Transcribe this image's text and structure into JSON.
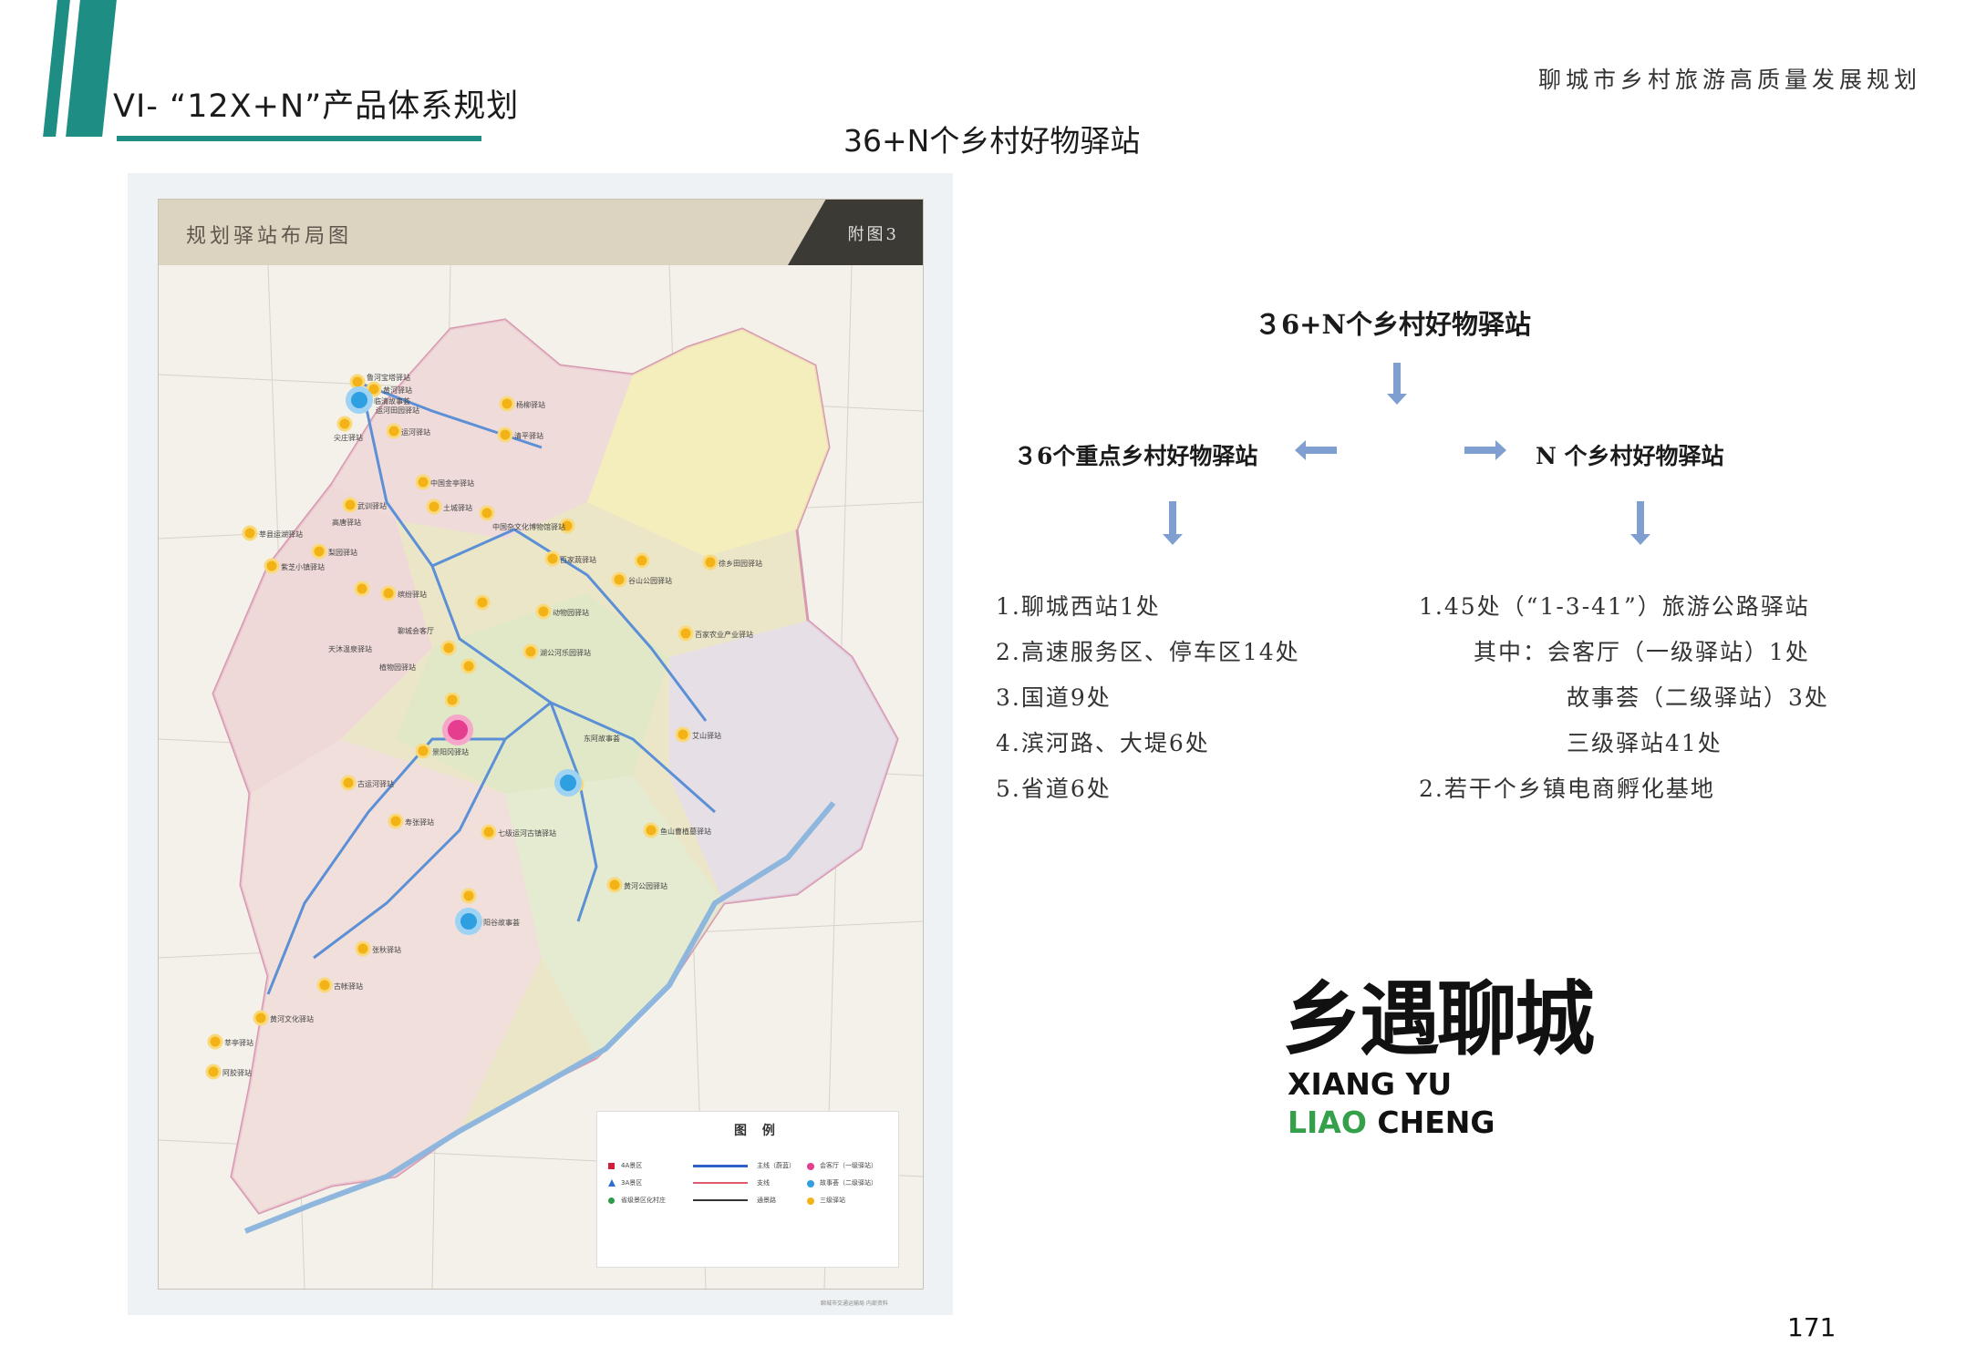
{
  "header": {
    "section_title": "VI- “12X+N”产品体系规划",
    "doc_title": "聊城市乡村旅游高质量发展规划",
    "page_heading": "36+N个乡村好物驿站"
  },
  "map": {
    "title": "规划驿站布局图",
    "appendix": "附图3",
    "legend_title": "图 例",
    "legend": {
      "symbols": [
        "4A景区",
        "3A景区",
        "省级景区化村庄"
      ],
      "lines": [
        "主线（蔚蓝）",
        "支线",
        "通景路"
      ],
      "stations": [
        "会客厅（一级驿站）",
        "故事荟（二级驿站）",
        "三级驿站"
      ]
    },
    "station_labels": [
      "鲁河宝塔驿站",
      "黄河驿站",
      "临清故事荟",
      "运河田园驿站",
      "尖庄驿站",
      "杨柳驿站",
      "清平驿站",
      "运河驿站",
      "中国金亭驿站",
      "武训驿站",
      "高唐驿站",
      "土城驿站",
      "中国杂文化博物馆驿站",
      "莘县运湖驿站",
      "梨园驿站",
      "紫芝小镇驿站",
      "百家蔬驿站",
      "谷山公园驿站",
      "徐乡田园驿站",
      "缤纷驿站",
      "动物园驿站",
      "聊城会客厅",
      "湖公河乐园驿站",
      "天沐温泉驿站",
      "植物园驿站",
      "百家农业产业驿站",
      "东阿故事荟",
      "阳谷故事荟",
      "寿张驿站",
      "七级运河古镇驿站",
      "景阳冈驿站",
      "古运河驿站",
      "艾山驿站",
      "鱼山曹植墓驿站",
      "古帐驿站",
      "张秋驿站",
      "黄河文化驿站",
      "莘亭驿站",
      "阿胶驿站",
      "黄河公园驿站"
    ],
    "footer": "聊城市交通运输局   内部资料"
  },
  "tree": {
    "root": "３6+N个乡村好物驿站",
    "left_title": "３6个重点乡村好物驿站",
    "right_title": "N 个乡村好物驿站",
    "left_items": [
      "1.聊城西站1处",
      "2.高速服务区、停车区14处",
      "3.国道9处",
      "4.滨河路、大堤6处",
      "5.省道6处"
    ],
    "right_items": [
      "1.45处（“1-3-41”）旅游公路驿站",
      "其中：会客厅（一级驿站）1处",
      "故事荟（二级驿站）3处",
      "三级驿站41处",
      "2.若干个乡镇电商孵化基地"
    ]
  },
  "logo": {
    "chinese": "乡遇聊城",
    "english_line1": "XIANG YU",
    "english_line2_a": "LIAO",
    "english_line2_b": "CHENG"
  },
  "page_number": "171",
  "colors": {
    "teal_accent": "#1e8d84",
    "arrow": "#7f9fd1",
    "station_yellow": "#f3b316",
    "station_pink": "#e53d8f",
    "station_blue": "#2e9fe0",
    "logo_green": "#35a04a"
  },
  "icons": [
    "down-arrow-icon",
    "left-arrow-icon",
    "right-arrow-icon",
    "station-dot-icon"
  ]
}
